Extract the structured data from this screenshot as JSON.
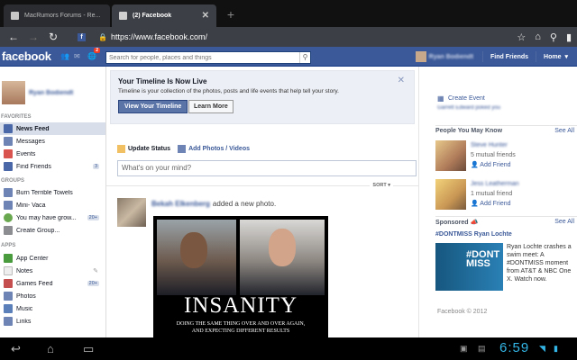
{
  "browser": {
    "tabs": [
      {
        "title": "MacRumors Forums - Re...",
        "active": false
      },
      {
        "title": "(2) Facebook",
        "active": true
      }
    ],
    "url": "https://www.facebook.com/",
    "favicon_letter": "f"
  },
  "fb": {
    "logo": "facebook",
    "notifications_count": "2",
    "search_placeholder": "Search for people, places and things",
    "find_friends": "Find Friends",
    "home": "Home"
  },
  "left": {
    "favorites_heading": "FAVORITES",
    "groups_heading": "GROUPS",
    "apps_heading": "APPS",
    "favorites": [
      {
        "label": "News Feed",
        "count": "",
        "color": "#4a67a8"
      },
      {
        "label": "Messages",
        "count": "",
        "color": "#6d84b4"
      },
      {
        "label": "Events",
        "count": "",
        "color": "#d9534f"
      },
      {
        "label": "Find Friends",
        "count": "3",
        "color": "#4a67a8"
      }
    ],
    "groups": [
      {
        "label": "Burn Terrible Towels",
        "count": "",
        "color": "#6d84b4"
      },
      {
        "label": "Mini- Vaca",
        "count": "",
        "color": "#6d84b4"
      },
      {
        "label": "You may have grow...",
        "count": "20+",
        "color": "#6aa84f"
      },
      {
        "label": "Create Group...",
        "count": "",
        "color": "#8b8d90"
      }
    ],
    "apps": [
      {
        "label": "App Center",
        "count": "",
        "color": "#4a9b3e"
      },
      {
        "label": "Notes",
        "count": "",
        "color": "#dddddd"
      },
      {
        "label": "Games Feed",
        "count": "20+",
        "color": "#c54f4f"
      },
      {
        "label": "Photos",
        "count": "",
        "color": "#6d84b4"
      },
      {
        "label": "Music",
        "count": "",
        "color": "#5b7fb8"
      },
      {
        "label": "Links",
        "count": "",
        "color": "#6d84b4"
      }
    ]
  },
  "timeline_promo": {
    "title": "Your Timeline Is Now Live",
    "description": "Timeline is your collection of the photos, posts and life events that help tell your story.",
    "primary_button": "View Your Timeline",
    "secondary_button": "Learn More"
  },
  "composer": {
    "update_status": "Update Status",
    "add_photos": "Add Photos / Videos",
    "placeholder": "What's on your mind?"
  },
  "feed": {
    "sort_label": "SORT",
    "story_action": "added a new photo.",
    "meme_title": "INSANITY",
    "meme_line1": "DOING THE SAME THING OVER AND OVER AGAIN,",
    "meme_line2": "AND EXPECTING DIFFERENT RESULTS"
  },
  "right": {
    "create_event": "Create Event",
    "pymk_heading": "People You May Know",
    "see_all": "See All",
    "people": [
      {
        "mutual": "5 mutual friends",
        "add": "Add Friend"
      },
      {
        "mutual": "1 mutual friend",
        "add": "Add Friend"
      }
    ],
    "sponsored_heading": "Sponsored",
    "ad_title": "#DONTMISS Ryan Lochte",
    "ad_image_text": "#DONT MISS",
    "ad_text": "Ryan Lochte crashes a swim meet: A #DONTMISS moment from AT&T & NBC One X. Watch now.",
    "footer_copyright": "Facebook © 2012"
  },
  "system": {
    "clock": "6:59"
  }
}
